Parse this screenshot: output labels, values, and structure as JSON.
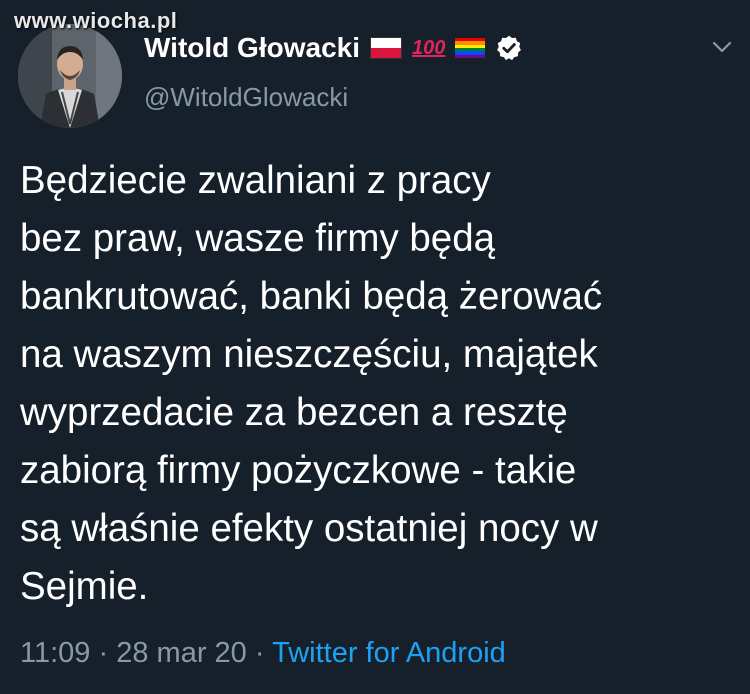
{
  "watermark": "www.wiocha.pl",
  "author": {
    "display_name": "Witold Głowacki",
    "handle": "@WitoldGlowacki",
    "badges": [
      "poland-flag-icon",
      "hundred-points-icon",
      "rainbow-flag-icon",
      "verified-icon"
    ],
    "hundred_text": "100"
  },
  "tweet": {
    "text": "Będziecie zwalniani z pracy\nbez praw, wasze firmy będą\nbankrutować, banki będą żerować\nna waszym nieszczęściu, majątek\nwyprzedacie za bezcen a resztę\nzabiorą firmy pożyczkowe - takie\nsą właśnie efekty ostatniej nocy w\nSejmie.",
    "time": "11:09",
    "sep1": "·",
    "date": "28 mar 20",
    "sep2": "·",
    "source": "Twitter for Android"
  },
  "colors": {
    "background": "#15202b",
    "text": "#ffffff",
    "secondary": "#8899a6",
    "link": "#1da1f2"
  }
}
